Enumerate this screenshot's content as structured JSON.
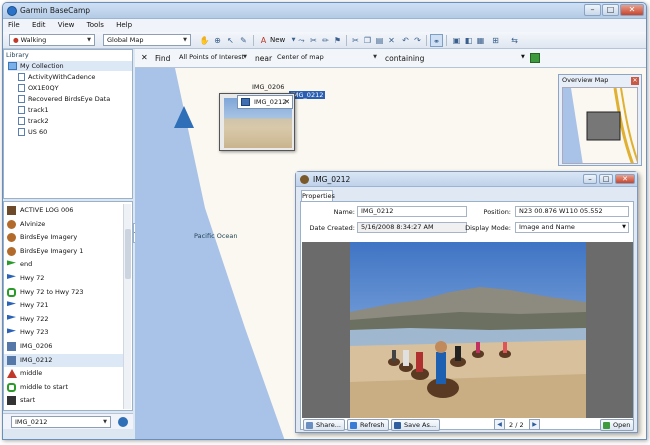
{
  "app": {
    "title": "Garmin BaseCamp"
  },
  "menu": [
    "File",
    "Edit",
    "View",
    "Tools",
    "Help"
  ],
  "toolbar": {
    "activity": "Walking",
    "map": "Global Map",
    "new_label": "New"
  },
  "library": {
    "label": "Library",
    "collection": "My Collection",
    "items": [
      "ActivityWithCadence",
      "OX1E0QY",
      "Recovered BirdsEye Data",
      "track1",
      "track2",
      "US 60"
    ]
  },
  "objects": {
    "items": [
      {
        "label": "ACTIVE LOG 006",
        "icon": "track-icon",
        "color": "#6d4b2a"
      },
      {
        "label": "Alvinize",
        "icon": "imagery-icon",
        "color": "#b36b2c"
      },
      {
        "label": "BirdsEye Imagery",
        "icon": "imagery-icon",
        "color": "#b36b2c"
      },
      {
        "label": "BirdsEye Imagery 1",
        "icon": "imagery-icon",
        "color": "#b36b2c"
      },
      {
        "label": "end",
        "icon": "flag-icon",
        "color": "#2a9b2a"
      },
      {
        "label": "Hwy 72",
        "icon": "flag-icon",
        "color": "#2a62b8"
      },
      {
        "label": "Hwy 72 to Hwy 723",
        "icon": "route-icon",
        "color": "#2a9b2a"
      },
      {
        "label": "Hwy 721",
        "icon": "flag-icon",
        "color": "#2a62b8"
      },
      {
        "label": "Hwy 722",
        "icon": "flag-icon",
        "color": "#2a62b8"
      },
      {
        "label": "Hwy 723",
        "icon": "flag-icon",
        "color": "#2a62b8"
      },
      {
        "label": "IMG_0206",
        "icon": "photo-icon",
        "color": "#5678a8"
      },
      {
        "label": "IMG_0212",
        "icon": "photo-icon",
        "color": "#5678a8"
      },
      {
        "label": "middle",
        "icon": "triangle-icon",
        "color": "#c0392b"
      },
      {
        "label": "middle to start",
        "icon": "route-icon",
        "color": "#2a9b2a"
      },
      {
        "label": "start",
        "icon": "camera-icon",
        "color": "#333333"
      }
    ],
    "selected": "IMG_0212",
    "footer_select": "IMG_0212"
  },
  "find": {
    "label": "Find",
    "scope": "All Points of Interest",
    "near_label": "near",
    "near": "Center of map",
    "containing_label": "containing"
  },
  "map": {
    "ocean_label": "Pacific Ocean",
    "label_img206": "IMG_0206",
    "label_img212": "IMG_0212",
    "bubble_label": "IMG_0212",
    "overview_title": "Overview Map"
  },
  "properties": {
    "title": "IMG_0212",
    "tab": "Properties",
    "name_label": "Name:",
    "name": "IMG_0212",
    "position_label": "Position:",
    "position": "N23 00.876 W110 05.552",
    "date_label": "Date Created:",
    "date": "5/16/2008 8:34:27 AM",
    "display_label": "Display Mode:",
    "display_mode": "Image and Name",
    "share": "Share...",
    "refresh": "Refresh",
    "save_as": "Save As...",
    "page": "2 / 2",
    "open": "Open"
  },
  "colors": {
    "ocean": "#a9c3e8",
    "highlight": "#2a5fb2",
    "accent": "#2f6fb8"
  }
}
